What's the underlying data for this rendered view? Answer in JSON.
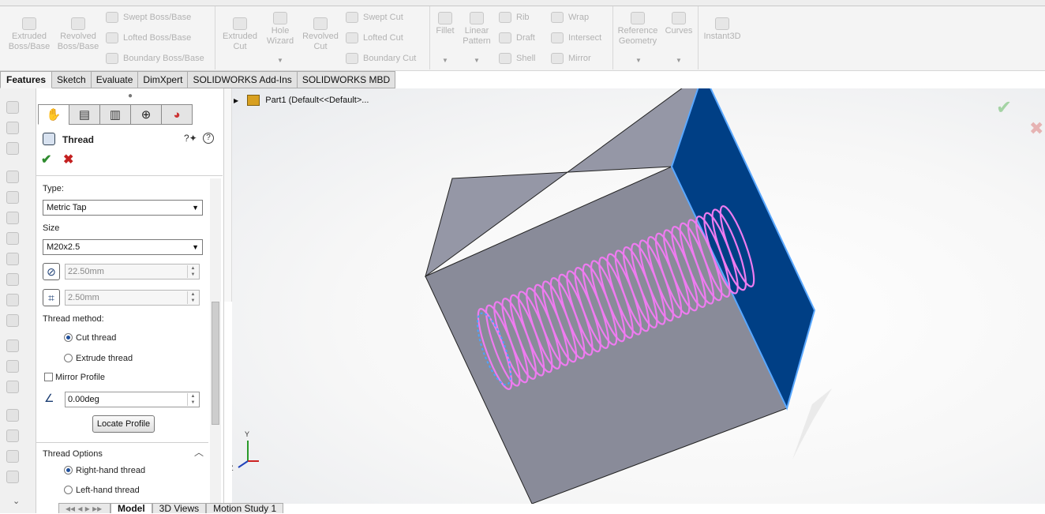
{
  "ribbon": {
    "extruded_boss": "Extruded Boss/Base",
    "revolved_boss": "Revolved Boss/Base",
    "swept_boss": "Swept Boss/Base",
    "lofted_boss": "Lofted Boss/Base",
    "boundary_boss": "Boundary Boss/Base",
    "extruded_cut": "Extruded Cut",
    "hole_wizard": "Hole Wizard",
    "revolved_cut": "Revolved Cut",
    "swept_cut": "Swept Cut",
    "lofted_cut": "Lofted Cut",
    "boundary_cut": "Boundary Cut",
    "fillet": "Fillet",
    "linear_pattern": "Linear Pattern",
    "rib": "Rib",
    "draft": "Draft",
    "shell": "Shell",
    "wrap": "Wrap",
    "intersect": "Intersect",
    "mirror": "Mirror",
    "reference_geometry": "Reference Geometry",
    "curves": "Curves",
    "instant3d": "Instant3D"
  },
  "command_tabs": [
    "Features",
    "Sketch",
    "Evaluate",
    "DimXpert",
    "SOLIDWORKS Add-Ins",
    "SOLIDWORKS MBD"
  ],
  "property_manager": {
    "title": "Thread",
    "type_label": "Type:",
    "type_value": "Metric Tap",
    "size_label": "Size",
    "size_value": "M20x2.5",
    "diameter_value": "22.50mm",
    "pitch_value": "2.50mm",
    "method_label": "Thread method:",
    "cut_thread": "Cut thread",
    "extrude_thread": "Extrude thread",
    "mirror_profile": "Mirror Profile",
    "angle_value": "0.00deg",
    "locate_profile": "Locate Profile",
    "thread_options": "Thread Options",
    "right_hand": "Right-hand thread",
    "left_hand": "Left-hand thread"
  },
  "tree": {
    "part_label": "Part1  (Default<<Default>..."
  },
  "triad": {
    "y": "Y",
    "z": "Z"
  },
  "bottom_tabs": [
    "Model",
    "3D Views",
    "Motion Study 1"
  ],
  "colors": {
    "thread_helix": "#ee7bf0",
    "box_side": "#8a8d9c",
    "box_top": "#9597a6",
    "box_face_selected": "#003f85",
    "edge_highlight": "#5aa8ff"
  }
}
